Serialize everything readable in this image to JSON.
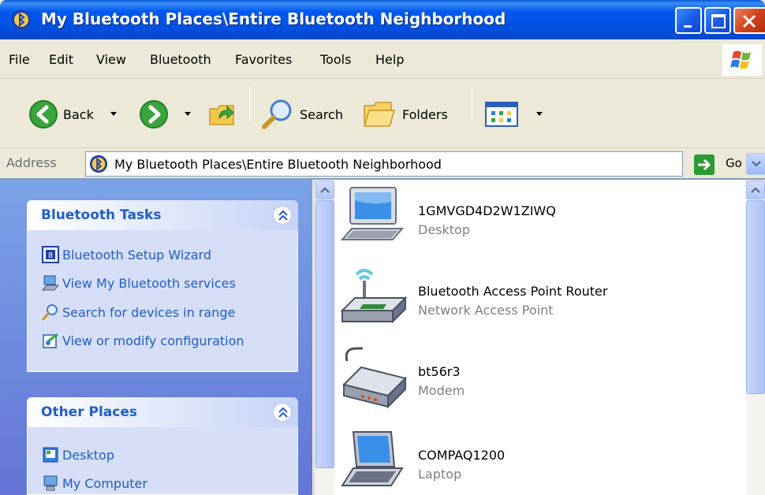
{
  "window": {
    "title": "My Bluetooth Places\\Entire Bluetooth Neighborhood"
  },
  "menu": [
    "File",
    "Edit",
    "View",
    "Bluetooth",
    "Favorites",
    "Tools",
    "Help"
  ],
  "toolbar": {
    "back_label": "Back",
    "search_label": "Search",
    "folders_label": "Folders"
  },
  "address": {
    "label": "Address",
    "value": "My Bluetooth Places\\Entire Bluetooth Neighborhood",
    "go_label": "Go"
  },
  "tasks_panel": {
    "title": "Bluetooth Tasks",
    "items": [
      {
        "label": "Bluetooth Setup Wizard",
        "icon": "wizard-icon"
      },
      {
        "label": "View My Bluetooth services",
        "icon": "computer-services-icon"
      },
      {
        "label": "Search for devices in range",
        "icon": "magnifier-icon"
      },
      {
        "label": "View or modify configuration",
        "icon": "configuration-icon"
      }
    ]
  },
  "places_panel": {
    "title": "Other Places",
    "items": [
      {
        "label": "Desktop",
        "icon": "desktop-icon"
      },
      {
        "label": "My Computer",
        "icon": "my-computer-icon"
      }
    ]
  },
  "devices": [
    {
      "name": "1GMVGD4D2W1ZIWQ",
      "type": "Desktop",
      "icon": "desktop-computer-icon"
    },
    {
      "name": "Bluetooth Access Point Router",
      "type": "Network Access Point",
      "icon": "access-point-icon"
    },
    {
      "name": "bt56r3",
      "type": "Modem",
      "icon": "modem-icon"
    },
    {
      "name": "COMPAQ1200",
      "type": "Laptop",
      "icon": "laptop-icon"
    }
  ],
  "colors": {
    "titlebar": "#0058ee",
    "taskpane": "#7ba2e7",
    "link": "#215dc6",
    "close": "#d2441d"
  }
}
